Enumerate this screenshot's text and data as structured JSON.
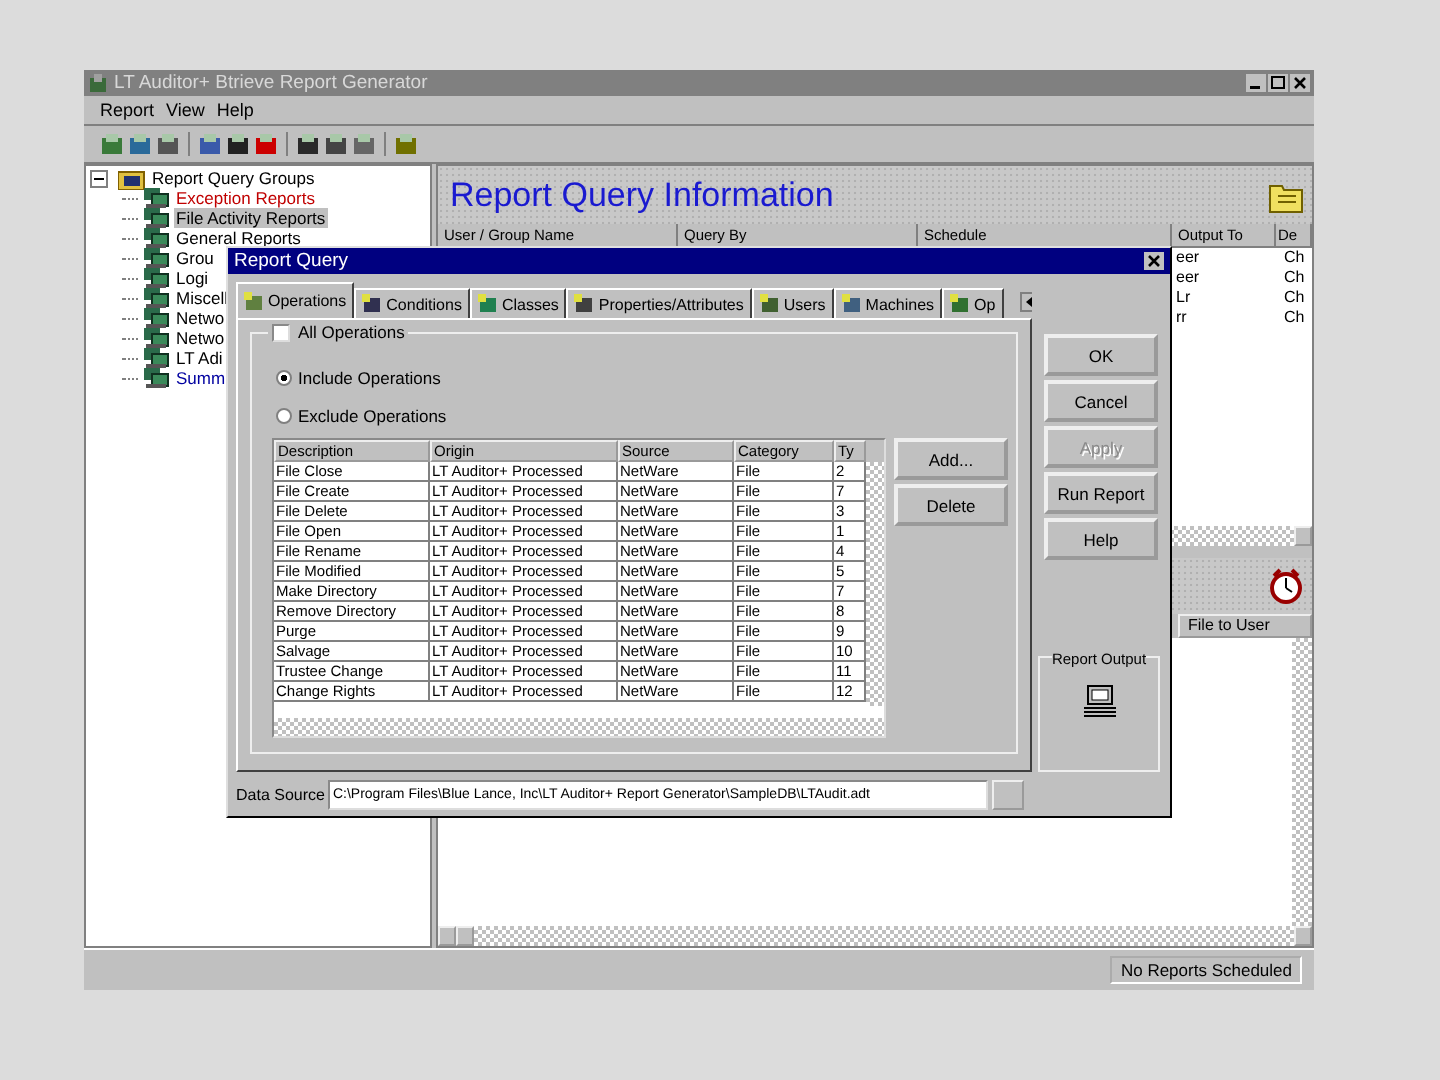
{
  "window": {
    "title": "LT Auditor+ Btrieve Report Generator"
  },
  "menu": [
    "Report",
    "View",
    "Help"
  ],
  "tree": {
    "label": "Report Query Groups",
    "expanded": true,
    "children": [
      {
        "label": "Exception Reports",
        "selected": false,
        "color": "#c00000"
      },
      {
        "label": "File Activity Reports",
        "selected": true,
        "color": "#000000"
      },
      {
        "label": "General Reports",
        "selected": false,
        "color": "#000000"
      },
      {
        "label": "Grou",
        "selected": false,
        "color": "#000000"
      },
      {
        "label": "Logi",
        "selected": false,
        "color": "#000000"
      },
      {
        "label": "Miscell",
        "selected": false,
        "color": "#000000"
      },
      {
        "label": "Netwo",
        "selected": false,
        "color": "#000000"
      },
      {
        "label": "Netwo",
        "selected": false,
        "color": "#000000"
      },
      {
        "label": "LT Adi",
        "selected": false,
        "color": "#000000"
      },
      {
        "label": "Summ",
        "selected": false,
        "color": "#0000a0"
      }
    ]
  },
  "info_panel": {
    "title": "Report Query Information",
    "columns": [
      "User / Group Name",
      "Query By",
      "Schedule",
      "Output To",
      "De"
    ],
    "rows": [
      {
        "column_4": "eer",
        "column_5": "Ch"
      },
      {
        "column_4": "eer",
        "column_5": "Ch"
      },
      {
        "column_4": "Lr",
        "column_5": "Ch"
      },
      {
        "column_4": "rr",
        "column_5": "Ch"
      }
    ]
  },
  "schedule_panel": {
    "columns": [
      "File to User"
    ]
  },
  "status_bar": "No Reports Scheduled",
  "dialog": {
    "title": "Report Query",
    "tabs": [
      {
        "label": "Operations",
        "selected": true
      },
      {
        "label": "Conditions",
        "selected": false
      },
      {
        "label": "Classes",
        "selected": false
      },
      {
        "label": "Properties/Attributes",
        "selected": false
      },
      {
        "label": "Users",
        "selected": false
      },
      {
        "label": "Machines",
        "selected": false
      },
      {
        "label": "Op",
        "selected": false
      }
    ],
    "all_operations": {
      "label": "All Operations",
      "checked": false
    },
    "radios": [
      {
        "label": "Include Operations",
        "selected": true
      },
      {
        "label": "Exclude Operations",
        "selected": false
      }
    ],
    "table": {
      "columns": [
        "Description",
        "Origin",
        "Source",
        "Category",
        "Ty"
      ],
      "rows": [
        [
          "File Close",
          "LT Auditor+ Processed",
          "NetWare",
          "File",
          "2"
        ],
        [
          "File Create",
          "LT Auditor+ Processed",
          "NetWare",
          "File",
          "7"
        ],
        [
          "File Delete",
          "LT Auditor+ Processed",
          "NetWare",
          "File",
          "3"
        ],
        [
          "File Open",
          "LT Auditor+ Processed",
          "NetWare",
          "File",
          "1"
        ],
        [
          "File Rename",
          "LT Auditor+ Processed",
          "NetWare",
          "File",
          "4"
        ],
        [
          "File Modified",
          "LT Auditor+ Processed",
          "NetWare",
          "File",
          "5"
        ],
        [
          "Make Directory",
          "LT Auditor+ Processed",
          "NetWare",
          "File",
          "7"
        ],
        [
          "Remove Directory",
          "LT Auditor+ Processed",
          "NetWare",
          "File",
          "8"
        ],
        [
          "Purge",
          "LT Auditor+ Processed",
          "NetWare",
          "File",
          "9"
        ],
        [
          "Salvage",
          "LT Auditor+ Processed",
          "NetWare",
          "File",
          "10"
        ],
        [
          "Trustee Change",
          "LT Auditor+ Processed",
          "NetWare",
          "File",
          "11"
        ],
        [
          "Change Rights",
          "LT Auditor+ Processed",
          "NetWare",
          "File",
          "12"
        ]
      ]
    },
    "table_buttons": [
      "Add...",
      "Delete"
    ],
    "buttons": [
      {
        "label": "OK",
        "disabled": false
      },
      {
        "label": "Cancel",
        "disabled": false
      },
      {
        "label": "Apply",
        "disabled": true
      },
      {
        "label": "Run Report",
        "disabled": false
      },
      {
        "label": "Help",
        "disabled": false
      }
    ],
    "report_output": {
      "label": "Report Output"
    },
    "data_source": {
      "label": "Data Source",
      "value": "C:\\Program Files\\Blue Lance, Inc\\LT Auditor+ Report Generator\\SampleDB\\LTAudit.adt"
    }
  }
}
